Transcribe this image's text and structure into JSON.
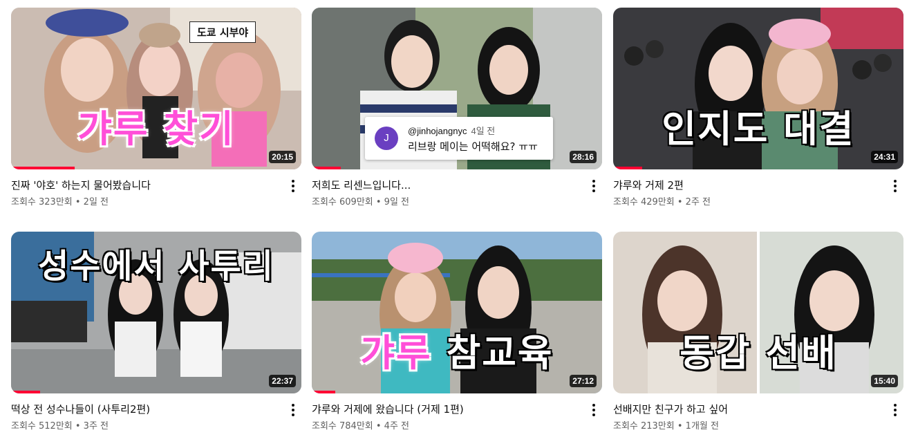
{
  "videos": [
    {
      "title": "진짜 '야호' 하는지 물어봤습니다",
      "stats": "조회수 323만회 • 2일 전",
      "duration": "20:15",
      "overlay": "갸루 찾기",
      "tag": "도쿄 시부야",
      "progress": 0.22
    },
    {
      "title": "저희도 리센느입니다...",
      "stats": "조회수 609만회 • 9일 전",
      "duration": "28:16",
      "comment": {
        "avatar": "J",
        "handle": "@jinhojangnyc",
        "time": "4일 전",
        "text": "리브랑 메이는 어떡해요? ㅠㅠ"
      },
      "progress": 0.1
    },
    {
      "title": "갸루와 거제 2편",
      "stats": "조회수 429만회 • 2주 전",
      "duration": "24:31",
      "overlay": "인지도 대결",
      "progress": 0.1
    },
    {
      "title": "떡상 전 성수나들이 (사투리2편)",
      "stats": "조회수 512만회 • 3주 전",
      "duration": "22:37",
      "overlay": "성수에서 사투리",
      "progress": 0.1
    },
    {
      "title": "갸루와 거제에 왔습니다 (거제 1편)",
      "stats": "조회수 784만회 • 4주 전",
      "duration": "27:12",
      "overlay_a": "갸루",
      "overlay_b": "참교육",
      "progress": 0.08
    },
    {
      "title": "선배지만 친구가 하고 싶어",
      "stats": "조회수 213만회 • 1개월 전",
      "duration": "15:40",
      "overlay": "동갑 선배",
      "progress": 0.0
    }
  ],
  "colors": {
    "progress": "#ff0033",
    "overlay_pink": "#ff4fd8",
    "avatar_purple": "#6a3fc1"
  }
}
